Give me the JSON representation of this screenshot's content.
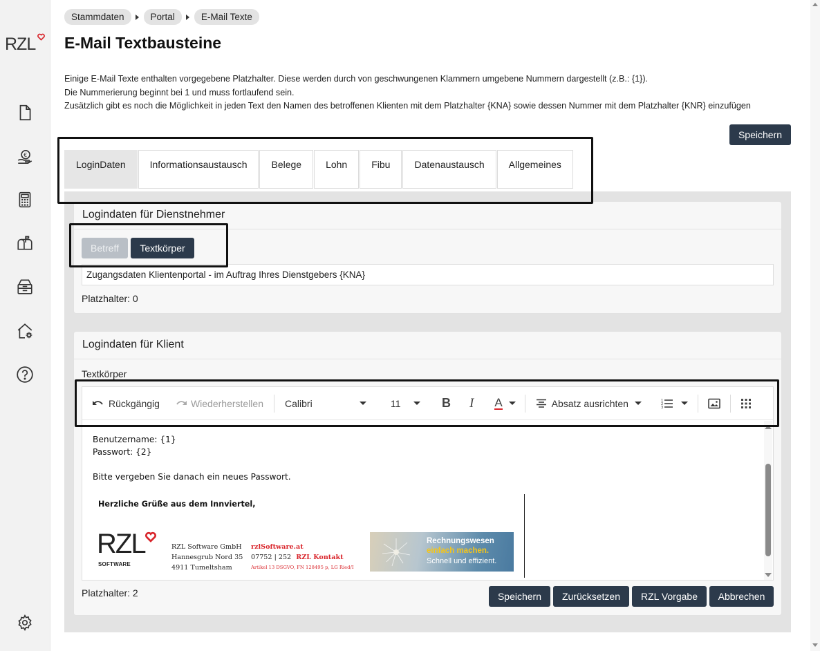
{
  "sidebar": {
    "logo_text": "RZL",
    "icons": [
      "document-icon",
      "money-hand-icon",
      "calculator-icon",
      "mailbox-icon",
      "archive-box-icon",
      "home-settings-icon",
      "help-icon",
      "settings-icon"
    ]
  },
  "breadcrumb": [
    "Stammdaten",
    "Portal",
    "E-Mail Texte"
  ],
  "page_title": "E-Mail Textbausteine",
  "intro": [
    "Einige E-Mail Texte enthalten vorgegebene Platzhalter. Diese werden durch von geschwungenen Klammern umgebene Nummern dargestellt (z.B.: {1}).",
    "Die Nummerierung beginnt bei 1 und muss fortlaufend sein.",
    "Zusätzlich gibt es noch die Möglichkeit in jeden Text den Namen des betroffenen Klienten mit dem Platzhalter {KNA} sowie dessen Nummer mit dem Platzhalter {KNR} einzufügen"
  ],
  "save_top_label": "Speichern",
  "tabs": [
    "LoginDaten",
    "Informationsaustausch",
    "Belege",
    "Lohn",
    "Fibu",
    "Datenaustausch",
    "Allgemeines"
  ],
  "active_tab": "LoginDaten",
  "panel1": {
    "title": "Logindaten für Dienstnehmer",
    "subtab_subject": "Betreff",
    "subtab_body": "Textkörper",
    "subject_value": "Zugangsdaten Klientenportal - im Auftrag Ihres Dienstgebers {KNA}",
    "placeholders": "Platzhalter: 0"
  },
  "panel2": {
    "title": "Logindaten für Klient",
    "body_label": "Textkörper",
    "toolbar": {
      "undo": "Rückgängig",
      "redo": "Wiederherstellen",
      "font": "Calibri",
      "size": "11",
      "align": "Absatz ausrichten"
    },
    "body_lines": [
      "Benutzername: {1}",
      "Passwort: {2}",
      "",
      "Bitte vergeben Sie danach ein neues Passwort."
    ],
    "signature": {
      "greeting": "Herzliche Grüße aus dem Innviertel,",
      "logo_text": "RZL",
      "logo_sub": "SOFTWARE",
      "company": [
        "RZL Software GmbH",
        "Hannesgrub Nord 35",
        "4911 Tumeltsham"
      ],
      "web": "rzlSoftware.at",
      "phone": "07752 | 252",
      "contact": "RZL Kontakt",
      "legal": "Artikel 13 DSGVO, FN 128495 p, LG Ried/I",
      "banner": [
        "Rechnungswesen",
        "einfach machen.",
        "Schnell und effizient."
      ]
    },
    "placeholders": "Platzhalter: 2",
    "buttons": [
      "Speichern",
      "Zurücksetzen",
      "RZL Vorgabe",
      "Abbrechen"
    ]
  },
  "colors": {
    "primary_dark": "#2c3a4b",
    "brand_red": "#d9252b",
    "disabled_button": "#b9bfc6"
  }
}
